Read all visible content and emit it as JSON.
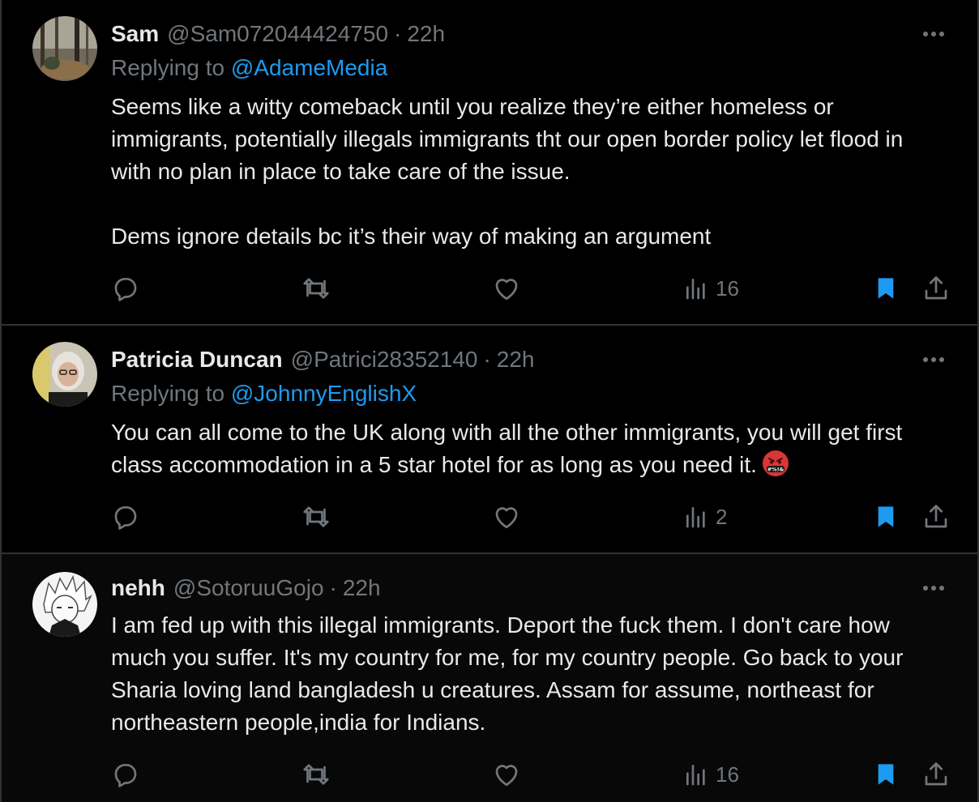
{
  "tweets": [
    {
      "author": "Sam",
      "handle": "@Sam072044424750",
      "separator": "·",
      "time": "22h",
      "replying_prefix": "Replying to",
      "replying_to": "@AdameMedia",
      "text": "Seems like a witty comeback until you realize they’re either homeless or immigrants, potentially illegals immigrants tht our open border policy let flood in with no plan in place to take care of the issue.\n\nDems ignore details bc it’s their way of making an argument",
      "views": "16",
      "bookmarked": true
    },
    {
      "author": "Patricia Duncan",
      "handle": "@Patrici28352140",
      "separator": "·",
      "time": "22h",
      "replying_prefix": "Replying to",
      "replying_to": "@JohnnyEnglishX",
      "text": "You can all come to the UK along with all the other immigrants, you will get first class accommodation in a 5 star hotel for as long as you need it.",
      "emoji": "face-with-symbols-on-mouth-icon",
      "views": "2",
      "bookmarked": true
    },
    {
      "author": "nehh",
      "handle": "@SotoruuGojo",
      "separator": "·",
      "time": "22h",
      "text": "I am fed up with this illegal immigrants. Deport the fuck them. I don't care how much you suffer. It's my country for me, for my country people. Go back to your Sharia loving land bangladesh u creatures. Assam for assume, northeast for northeastern people,india for Indians.",
      "views": "16",
      "bookmarked": true
    }
  ],
  "colors": {
    "background": "#000000",
    "text": "#e7e9ea",
    "secondary": "#71767b",
    "accent": "#1d9bf0",
    "divider": "#2f3336"
  },
  "icons": [
    "reply-icon",
    "retweet-icon",
    "like-icon",
    "views-icon",
    "bookmark-icon",
    "share-icon",
    "more-icon"
  ]
}
